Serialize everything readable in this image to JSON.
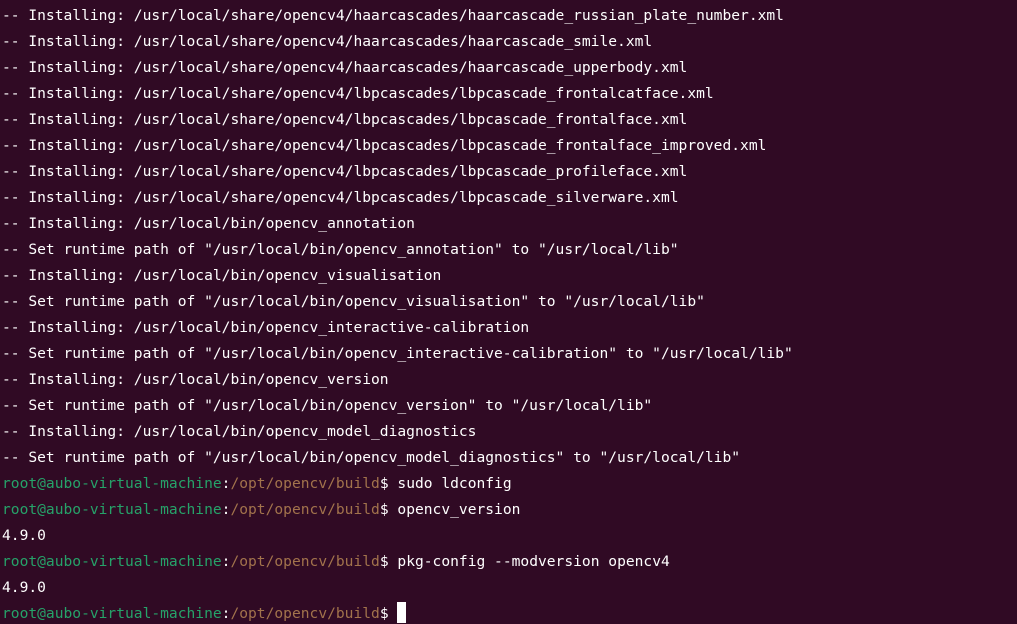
{
  "terminal": {
    "output_lines": [
      "-- Installing: /usr/local/share/opencv4/haarcascades/haarcascade_russian_plate_number.xml",
      "-- Installing: /usr/local/share/opencv4/haarcascades/haarcascade_smile.xml",
      "-- Installing: /usr/local/share/opencv4/haarcascades/haarcascade_upperbody.xml",
      "-- Installing: /usr/local/share/opencv4/lbpcascades/lbpcascade_frontalcatface.xml",
      "-- Installing: /usr/local/share/opencv4/lbpcascades/lbpcascade_frontalface.xml",
      "-- Installing: /usr/local/share/opencv4/lbpcascades/lbpcascade_frontalface_improved.xml",
      "-- Installing: /usr/local/share/opencv4/lbpcascades/lbpcascade_profileface.xml",
      "-- Installing: /usr/local/share/opencv4/lbpcascades/lbpcascade_silverware.xml",
      "-- Installing: /usr/local/bin/opencv_annotation",
      "-- Set runtime path of \"/usr/local/bin/opencv_annotation\" to \"/usr/local/lib\"",
      "-- Installing: /usr/local/bin/opencv_visualisation",
      "-- Set runtime path of \"/usr/local/bin/opencv_visualisation\" to \"/usr/local/lib\"",
      "-- Installing: /usr/local/bin/opencv_interactive-calibration",
      "-- Set runtime path of \"/usr/local/bin/opencv_interactive-calibration\" to \"/usr/local/lib\"",
      "-- Installing: /usr/local/bin/opencv_version",
      "-- Set runtime path of \"/usr/local/bin/opencv_version\" to \"/usr/local/lib\"",
      "-- Installing: /usr/local/bin/opencv_model_diagnostics",
      "-- Set runtime path of \"/usr/local/bin/opencv_model_diagnostics\" to \"/usr/local/lib\""
    ],
    "prompt": {
      "user_host": "root@aubo-virtual-machine",
      "separator": ":",
      "path": "/opt/opencv/build",
      "symbol": "$"
    },
    "session": [
      {
        "type": "command",
        "text": " sudo ldconfig"
      },
      {
        "type": "command",
        "text": " opencv_version"
      },
      {
        "type": "output",
        "text": "4.9.0"
      },
      {
        "type": "command",
        "text": " pkg-config --modversion opencv4"
      },
      {
        "type": "output",
        "text": "4.9.0"
      },
      {
        "type": "command",
        "text": " "
      }
    ],
    "colors": {
      "background": "#300a24",
      "text": "#ffffff",
      "user_host": "#26a269",
      "path": "#a2734c"
    }
  }
}
